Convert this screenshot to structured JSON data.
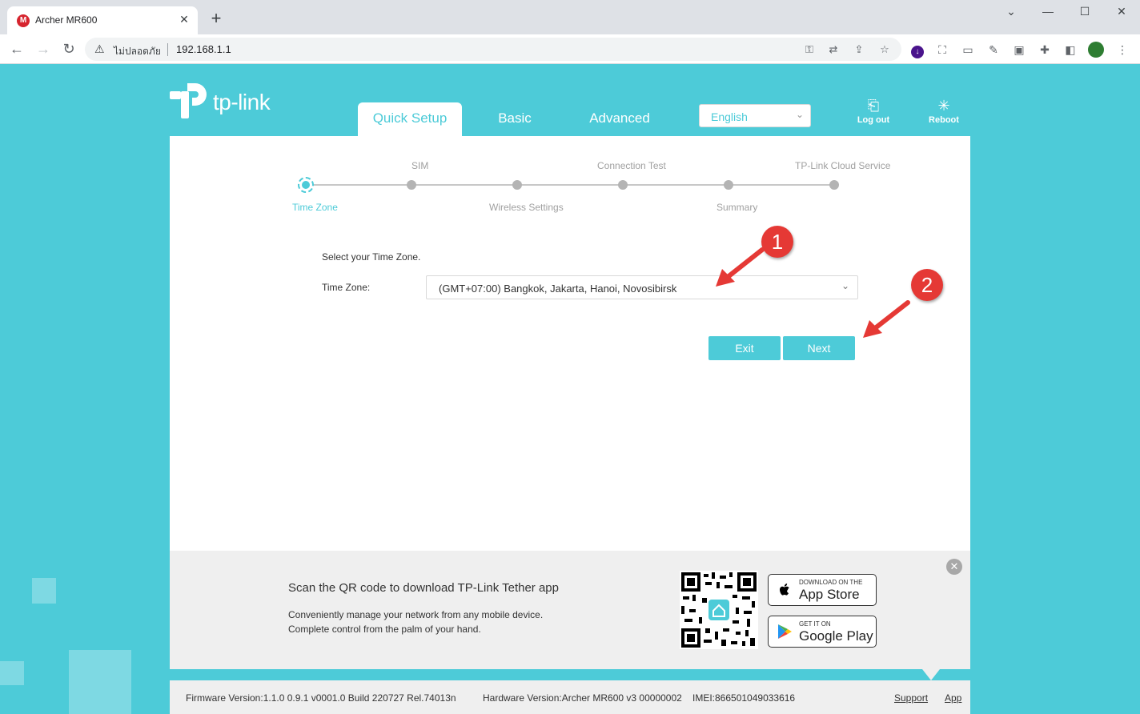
{
  "browser": {
    "tab_title": "Archer MR600",
    "favicon_letter": "M",
    "security_label": "ไม่ปลอดภัย",
    "url": "192.168.1.1"
  },
  "header": {
    "logo_text": "tp-link",
    "tabs": [
      {
        "label": "Quick Setup",
        "active": true
      },
      {
        "label": "Basic",
        "active": false
      },
      {
        "label": "Advanced",
        "active": false
      }
    ],
    "language": "English",
    "logout_label": "Log out",
    "reboot_label": "Reboot"
  },
  "wizard": {
    "steps": [
      {
        "label": "Time Zone",
        "active": true
      },
      {
        "label": "SIM",
        "active": false
      },
      {
        "label": "Wireless Settings",
        "active": false
      },
      {
        "label": "Connection Test",
        "active": false
      },
      {
        "label": "Summary",
        "active": false
      },
      {
        "label": "TP-Link Cloud Service",
        "active": false
      }
    ],
    "prompt": "Select your Time Zone.",
    "field_label": "Time Zone:",
    "timezone_value": "(GMT+07:00) Bangkok, Jakarta, Hanoi, Novosibirsk",
    "exit_label": "Exit",
    "next_label": "Next"
  },
  "annotations": [
    "1",
    "2"
  ],
  "promo": {
    "title": "Scan the QR code to download TP-Link Tether app",
    "line1": "Conveniently manage your network from any mobile device.",
    "line2": "Complete control from the palm of your hand.",
    "appstore_small": "DOWNLOAD ON THE",
    "appstore_big": "App Store",
    "googleplay_small": "GET IT ON",
    "googleplay_big": "Google Play"
  },
  "footer": {
    "firmware": "Firmware Version:1.1.0 0.9.1 v0001.0 Build 220727 Rel.74013n",
    "hardware": "Hardware Version:Archer MR600 v3 00000002",
    "imei": "IMEI:866501049033616",
    "support": "Support",
    "app": "App"
  },
  "colors": {
    "brand": "#4dcbd8",
    "annotation": "#e53935"
  }
}
